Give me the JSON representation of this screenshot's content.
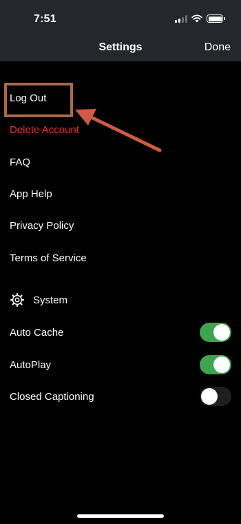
{
  "status_bar": {
    "time": "7:51"
  },
  "nav": {
    "title": "Settings",
    "done_label": "Done"
  },
  "account": {
    "log_out": "Log Out",
    "delete_account": "Delete Account"
  },
  "info_links": [
    "FAQ",
    "App Help",
    "Privacy Policy",
    "Terms of Service"
  ],
  "system": {
    "section_title": "System",
    "toggles": [
      {
        "label": "Auto Cache",
        "on": true
      },
      {
        "label": "AutoPlay",
        "on": true
      },
      {
        "label": "Closed Captioning",
        "on": false
      }
    ]
  },
  "colors": {
    "header_bg": "#24272b",
    "danger": "#e0312b",
    "toggle_on": "#3ea44f",
    "annotation": "#a96a4a",
    "arrow": "#d05a42"
  }
}
